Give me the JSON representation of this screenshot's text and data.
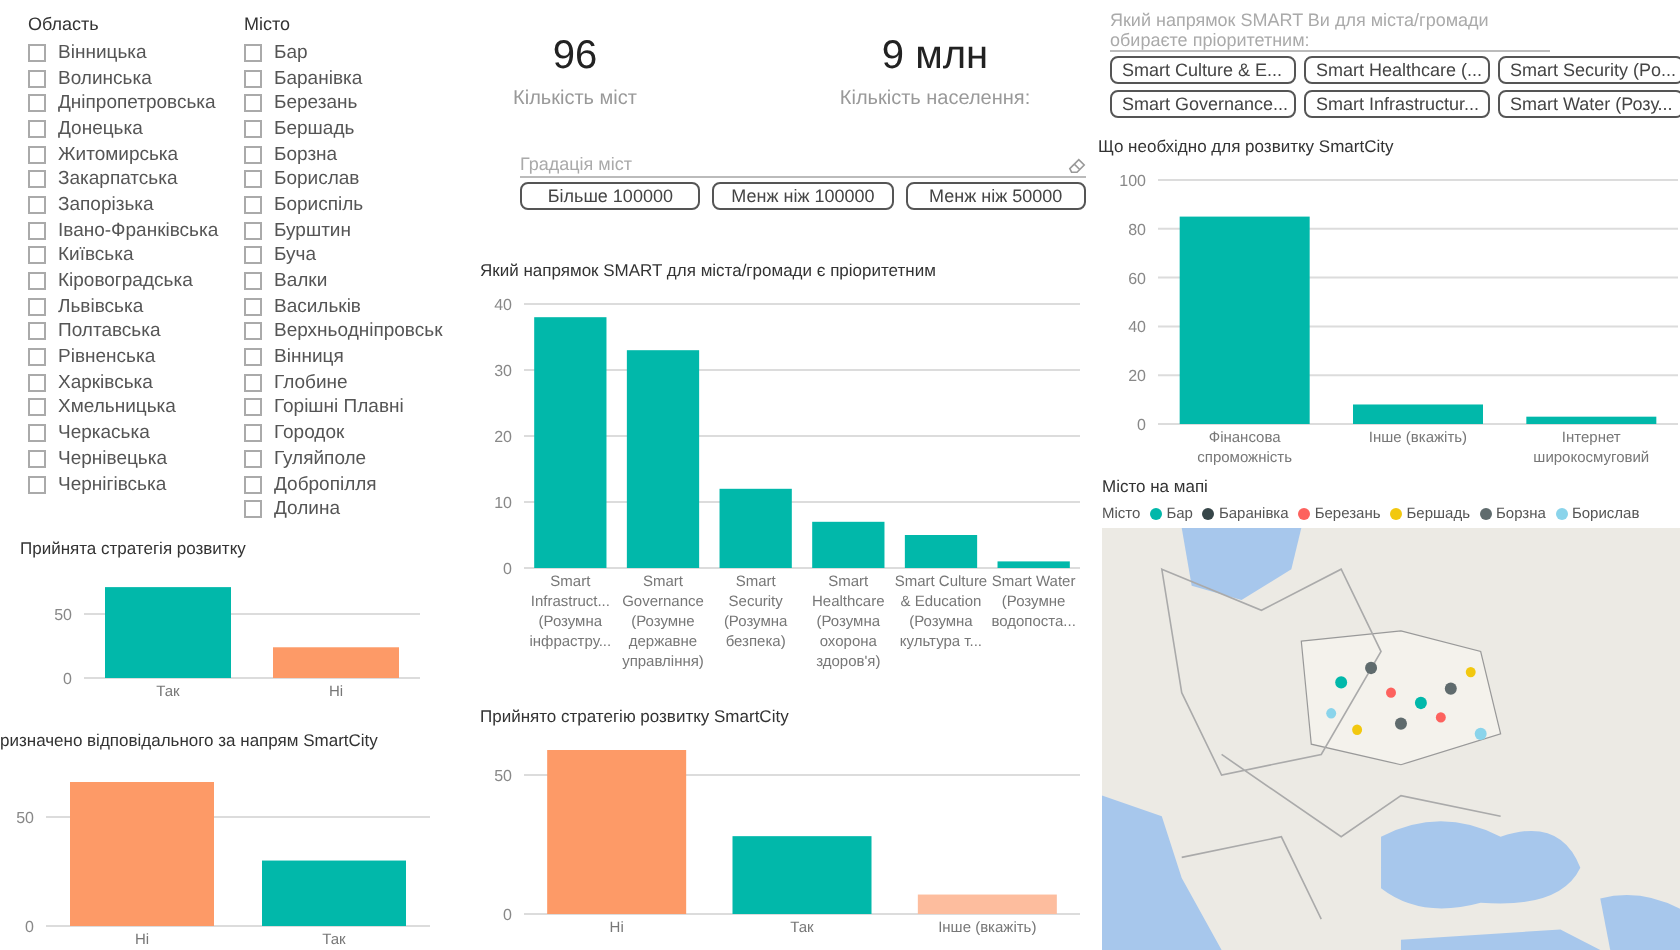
{
  "region_slicer": {
    "title": "Область",
    "items": [
      {
        "label": "Вінницька",
        "checked": false
      },
      {
        "label": "Волинська",
        "checked": false
      },
      {
        "label": "Дніпропетровська",
        "checked": false
      },
      {
        "label": "Донецька",
        "checked": false
      },
      {
        "label": "Житомирська",
        "checked": false
      },
      {
        "label": "Закарпатська",
        "checked": false
      },
      {
        "label": "Запорізька",
        "checked": false
      },
      {
        "label": "Івано-Франківська",
        "checked": false
      },
      {
        "label": "Київська",
        "checked": false
      },
      {
        "label": "Кіровоградська",
        "checked": false
      },
      {
        "label": "Львівська",
        "checked": false
      },
      {
        "label": "Полтавська",
        "checked": false
      },
      {
        "label": "Рівненська",
        "checked": false
      },
      {
        "label": "Харківська",
        "checked": false
      },
      {
        "label": "Хмельницька",
        "checked": false
      },
      {
        "label": "Черкаська",
        "checked": false
      },
      {
        "label": "Чернівецька",
        "checked": false
      },
      {
        "label": "Чернігівська",
        "checked": false
      }
    ]
  },
  "city_slicer": {
    "title": "Місто",
    "items": [
      {
        "label": "Бар",
        "checked": false
      },
      {
        "label": "Баранівка",
        "checked": false
      },
      {
        "label": "Березань",
        "checked": false
      },
      {
        "label": "Бершадь",
        "checked": false
      },
      {
        "label": "Борзна",
        "checked": false
      },
      {
        "label": "Борислав",
        "checked": false
      },
      {
        "label": "Бориспіль",
        "checked": false
      },
      {
        "label": "Бурштин",
        "checked": false
      },
      {
        "label": "Буча",
        "checked": false
      },
      {
        "label": "Валки",
        "checked": false
      },
      {
        "label": "Васильків",
        "checked": false
      },
      {
        "label": "Верхньодніпровськ",
        "checked": false
      },
      {
        "label": "Вінниця",
        "checked": false
      },
      {
        "label": "Глобине",
        "checked": false
      },
      {
        "label": "Горішні Плавні",
        "checked": false
      },
      {
        "label": "Городок",
        "checked": false
      },
      {
        "label": "Гуляйполе",
        "checked": false
      },
      {
        "label": "Добропілля",
        "checked": false
      },
      {
        "label": "Долина",
        "checked": false
      }
    ]
  },
  "kpis": [
    {
      "value": "96",
      "label": "Кількість міст"
    },
    {
      "value": "9 млн",
      "label": "Кількість населення:"
    }
  ],
  "size_slicer": {
    "title": "Градація міст",
    "buttons": [
      {
        "label": "Більше 100000",
        "selected": false
      },
      {
        "label": "Менж ніж 100000",
        "selected": false
      },
      {
        "label": "Менж ніж 50000",
        "selected": false
      }
    ]
  },
  "smart_slicer": {
    "title": "Який напрямок SMART Ви для міста/громади обираєте пріоритетним:",
    "buttons": [
      {
        "label": "Smart Culture & E...",
        "selected": false
      },
      {
        "label": "Smart Healthcare (...",
        "selected": false
      },
      {
        "label": "Smart Security (Po...",
        "selected": false
      },
      {
        "label": "Smart Governance...",
        "selected": false
      },
      {
        "label": "Smart Infrastructur...",
        "selected": false
      },
      {
        "label": "Smart Water (Розу...",
        "selected": false
      }
    ]
  },
  "charts": [
    {
      "chart_data": {
        "type": "bar",
        "title": "Прийнята стратегія розвитку",
        "categories": [
          "Так",
          "Ні"
        ],
        "colors": [
          "#01b8aa",
          "#fd9a67"
        ],
        "values": [
          71,
          24
        ],
        "ylim": [
          0,
          75
        ],
        "yticks": [
          0,
          50
        ],
        "grid": true
      }
    },
    {
      "chart_data": {
        "type": "bar",
        "title": "ризначено відповідального за напрям SmartCity",
        "categories": [
          "Ні",
          "Так"
        ],
        "colors": [
          "#fd9a67",
          "#01b8aa"
        ],
        "values": [
          66,
          30
        ],
        "ylim": [
          0,
          66
        ],
        "yticks": [
          0,
          50
        ],
        "grid": true
      }
    },
    {
      "chart_data": {
        "type": "bar",
        "title": "Який напрямок SMART для міста/громади є пріоритетним",
        "categories": [
          "Smart Infrastruct... (Розумна інфрастру...",
          "Smart Governance (Розумне державне управління)",
          "Smart Security (Розумна безпека)",
          "Smart Healthcare (Розумна охорона здоров'я)",
          "Smart Culture & Education (Розумна культура т...",
          "Smart Water (Розумне водопоста..."
        ],
        "colors": [
          "#01b8aa",
          "#01b8aa",
          "#01b8aa",
          "#01b8aa",
          "#01b8aa",
          "#01b8aa"
        ],
        "values": [
          38,
          33,
          12,
          7,
          5,
          1
        ],
        "ylim": [
          0,
          40
        ],
        "yticks": [
          0,
          10,
          20,
          30,
          40
        ],
        "grid": true
      }
    },
    {
      "chart_data": {
        "type": "bar",
        "title": "Прийнято стратегію розвитку SmartCity",
        "categories": [
          "Ні",
          "Так",
          "Інше (вкажіть)"
        ],
        "colors": [
          "#fd9a67",
          "#01b8aa",
          "#fdbd9e"
        ],
        "values": [
          59,
          28,
          7
        ],
        "ylim": [
          0,
          59
        ],
        "yticks": [
          0,
          50
        ],
        "grid": true
      }
    },
    {
      "chart_data": {
        "type": "bar",
        "title": "Що необхідно для розвитку SmartCity",
        "categories": [
          "Фінансова спроможність",
          "Інше (вкажіть)",
          "Інтернет широкосмуговий"
        ],
        "colors": [
          "#01b8aa",
          "#01b8aa",
          "#01b8aa"
        ],
        "values": [
          85,
          8,
          3
        ],
        "ylim": [
          0,
          100
        ],
        "yticks": [
          0,
          20,
          40,
          60,
          80,
          100
        ],
        "grid": true
      }
    }
  ],
  "map": {
    "title": "Місто на мапі",
    "legend_title": "Місто",
    "legend": [
      {
        "label": "Бар",
        "color": "#01b8aa"
      },
      {
        "label": "Баранівка",
        "color": "#374649"
      },
      {
        "label": "Березань",
        "color": "#fd625e"
      },
      {
        "label": "Бершадь",
        "color": "#f2c80f"
      },
      {
        "label": "Борзна",
        "color": "#5f6b6d"
      },
      {
        "label": "Борислав",
        "color": "#8ad4eb"
      }
    ],
    "kind": "picture"
  }
}
